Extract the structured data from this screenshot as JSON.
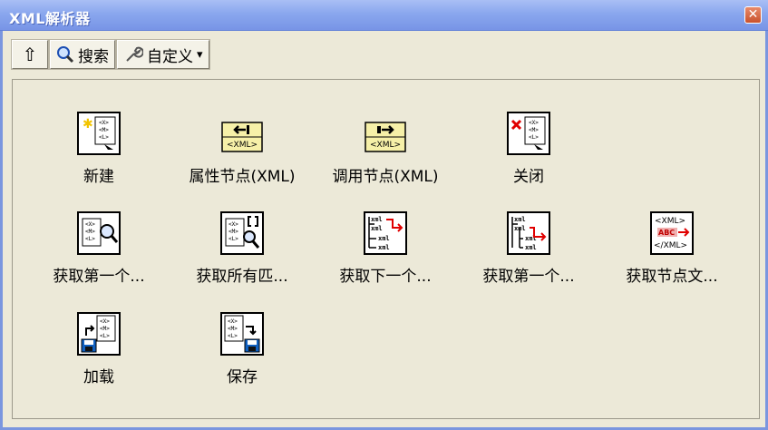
{
  "window": {
    "title": "XML解析器",
    "close_glyph": "✕"
  },
  "toolbar": {
    "up_glyph": "⇧",
    "search_label": "搜索",
    "customize_label": "自定义",
    "dropdown_glyph": "▾"
  },
  "icon_text": {
    "xml_tag": "<XML>",
    "xml_tag_close": "</XML>",
    "abc": "ABC",
    "doc_lines": [
      "<X>",
      "<M>",
      "<L>"
    ],
    "xml_small": "xml"
  },
  "items": [
    {
      "label": "新建"
    },
    {
      "label": "属性节点(XML)"
    },
    {
      "label": "调用节点(XML)"
    },
    {
      "label": "关闭"
    },
    {
      "label": "获取第一个..."
    },
    {
      "label": "获取所有匹..."
    },
    {
      "label": "获取下一个..."
    },
    {
      "label": "获取第一个..."
    },
    {
      "label": "获取节点文..."
    },
    {
      "label": "加载"
    },
    {
      "label": "保存"
    }
  ]
}
